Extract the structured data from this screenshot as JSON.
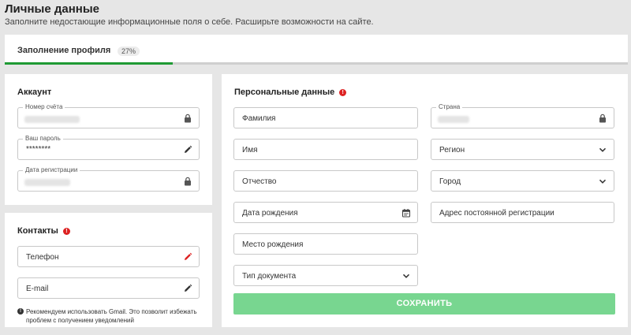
{
  "header": {
    "title": "Личные данные",
    "subtitle": "Заполните недостающие информационные поля о себе. Расширьте возможности на сайте."
  },
  "progress": {
    "label": "Заполнение профиля",
    "percent_label": "27%",
    "fraction": 0.27,
    "color": "#1f9a34"
  },
  "account": {
    "title": "Аккаунт",
    "account_number_label": "Номер счёта",
    "password_label": "Ваш пароль",
    "password_value": "********",
    "registration_date_label": "Дата регистрации"
  },
  "contacts": {
    "title": "Контакты",
    "phone_placeholder": "Телефон",
    "email_placeholder": "E-mail",
    "hint": "Рекомендуем использовать Gmail. Это позволит избежать проблем с получением уведомлений"
  },
  "personal": {
    "title": "Персональные данные",
    "last_name": "Фамилия",
    "first_name": "Имя",
    "patronymic": "Отчество",
    "birth_date": "Дата рождения",
    "birth_place": "Место рождения",
    "document_type": "Тип документа",
    "country_label": "Страна",
    "region": "Регион",
    "city": "Город",
    "registration_address": "Адрес постоянной регистрации",
    "save_label": "СОХРАНИТЬ"
  },
  "icons": {
    "lock": "lock-icon",
    "pencil": "pencil-icon",
    "calendar": "calendar-icon",
    "chevron": "chevron-down-icon",
    "warning": "warning-icon",
    "info": "info-icon"
  },
  "colors": {
    "accent_green": "#1f9a34",
    "save_button": "#78d690",
    "warning_red": "#d22222",
    "phone_pencil_red": "#d22222"
  }
}
